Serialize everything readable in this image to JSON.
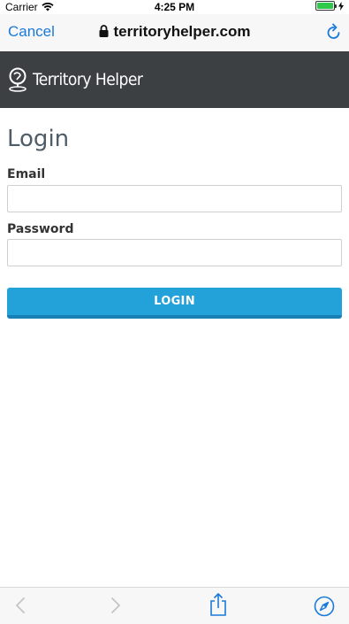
{
  "status_bar": {
    "carrier": "Carrier",
    "time": "4:25 PM",
    "battery_level": 1.0,
    "battery_color": "#2ec94a"
  },
  "browser": {
    "cancel_label": "Cancel",
    "url": "territoryhelper.com",
    "accent_color": "#1a7ad9"
  },
  "header": {
    "logo_text": "Territory Helper",
    "background": "#3c4043"
  },
  "form": {
    "title": "Login",
    "email_label": "Email",
    "email_value": "",
    "password_label": "Password",
    "password_value": "",
    "submit_label": "LOGIN",
    "button_color": "#23a1d9"
  },
  "toolbar": {
    "icons": [
      "back-icon",
      "forward-icon",
      "share-icon",
      "compass-icon"
    ]
  }
}
